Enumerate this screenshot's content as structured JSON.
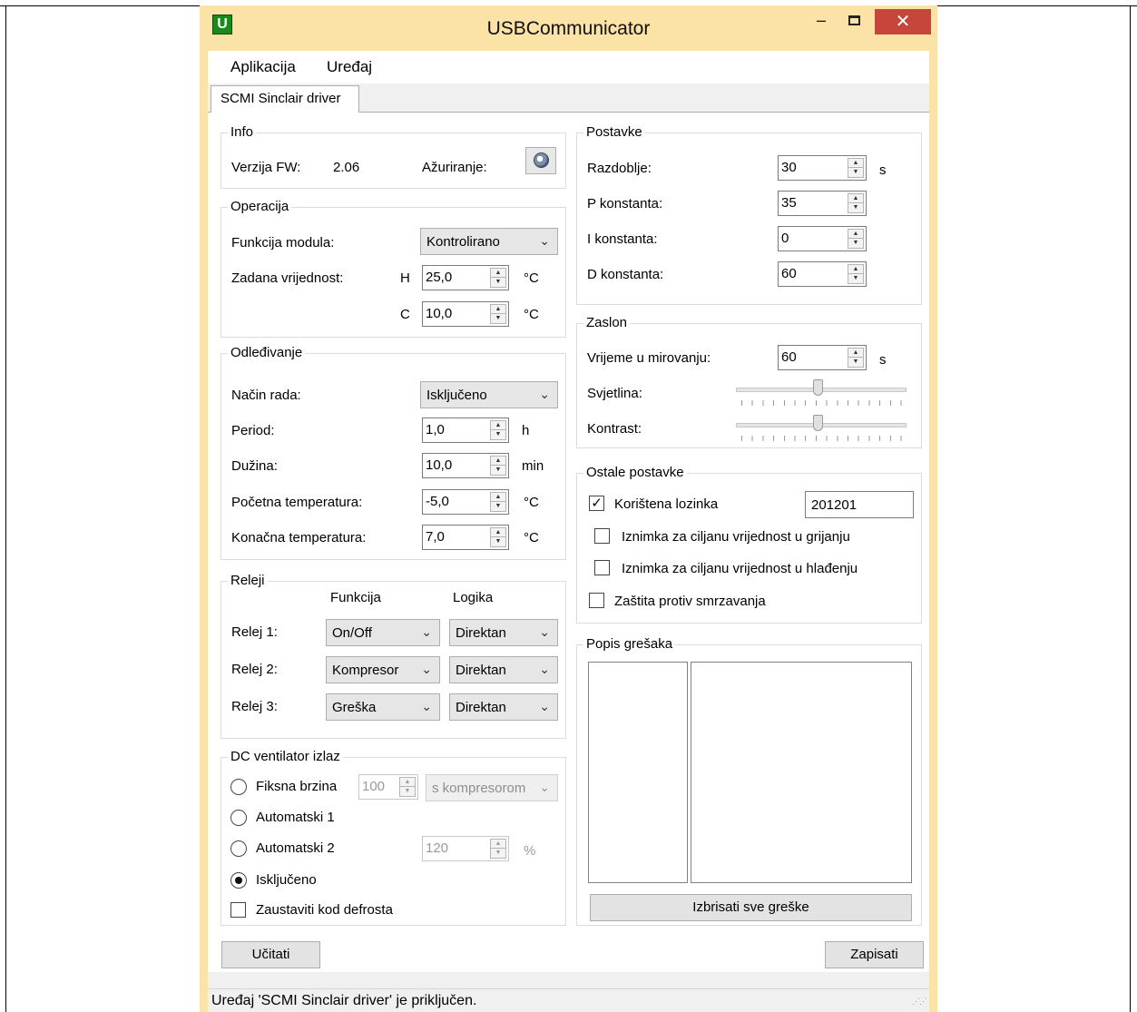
{
  "window": {
    "title": "USBCommunicator",
    "app_icon_letter": "U",
    "minimize_glyph": "‒",
    "close_glyph": "✕"
  },
  "menu": {
    "items": [
      "Aplikacija",
      "Uređaj"
    ]
  },
  "tab": {
    "label": "SCMI Sinclair driver"
  },
  "info": {
    "title": "Info",
    "fw_label": "Verzija FW:",
    "fw_value": "2.06",
    "update_label": "Ažuriranje:",
    "update_icon": "globe-icon"
  },
  "operacija": {
    "title": "Operacija",
    "function_label": "Funkcija modula:",
    "function_value": "Kontrolirano",
    "setpoint_label": "Zadana vrijednost:",
    "h_label": "H",
    "h_value": "25,0",
    "c_label": "C",
    "c_value": "10,0",
    "unit": "°C"
  },
  "odledjivanje": {
    "title": "Odleđivanje",
    "mode_label": "Način rada:",
    "mode_value": "Isključeno",
    "rows": [
      {
        "label": "Period:",
        "value": "1,0",
        "unit": "h"
      },
      {
        "label": "Dužina:",
        "value": "10,0",
        "unit": "min"
      },
      {
        "label": "Početna temperatura:",
        "value": "-5,0",
        "unit": "°C"
      },
      {
        "label": "Konačna temperatura:",
        "value": "7,0",
        "unit": "°C"
      }
    ]
  },
  "releji": {
    "title": "Releji",
    "col_function": "Funkcija",
    "col_logic": "Logika",
    "rows": [
      {
        "label": "Relej 1:",
        "function": "On/Off",
        "logic": "Direktan"
      },
      {
        "label": "Relej 2:",
        "function": "Kompresor",
        "logic": "Direktan"
      },
      {
        "label": "Relej 3:",
        "function": "Greška",
        "logic": "Direktan"
      }
    ]
  },
  "dc_ventilator": {
    "title": "DC ventilator izlaz",
    "fixed_label": "Fiksna brzina",
    "fixed_value": "100",
    "fixed_mode": "s kompresorom",
    "auto1_label": "Automatski 1",
    "auto2_label": "Automatski 2",
    "auto2_value": "120",
    "auto2_unit": "%",
    "off_label": "Isključeno",
    "selected": "off",
    "stop_defrost_label": "Zaustaviti kod defrosta"
  },
  "postavke": {
    "title": "Postavke",
    "rows": [
      {
        "label": "Razdoblje:",
        "value": "30",
        "unit": "s"
      },
      {
        "label": "P konstanta:",
        "value": "35",
        "unit": ""
      },
      {
        "label": "I konstanta:",
        "value": "0",
        "unit": ""
      },
      {
        "label": "D konstanta:",
        "value": "60",
        "unit": ""
      }
    ]
  },
  "zaslon": {
    "title": "Zaslon",
    "idle_label": "Vrijeme u mirovanju:",
    "idle_value": "60",
    "idle_unit": "s",
    "brightness_label": "Svjetlina:",
    "brightness_level": 0.48,
    "contrast_label": "Kontrast:",
    "contrast_level": 0.48
  },
  "ostale": {
    "title": "Ostale postavke",
    "password_label": "Korištena lozinka",
    "password_checked": true,
    "password_value": "201201",
    "exc_heating_label": "Iznimka za ciljanu vrijednost u grijanju",
    "exc_cooling_label": "Iznimka za ciljanu vrijednost u hlađenju",
    "frost_label": "Zaštita protiv smrzavanja"
  },
  "errors": {
    "title": "Popis grešaka",
    "clear_label": "Izbrisati sve greške"
  },
  "actions": {
    "load_label": "Učitati",
    "save_label": "Zapisati"
  },
  "status": {
    "text": "Uređaj 'SCMI Sinclair driver' je priključen."
  }
}
